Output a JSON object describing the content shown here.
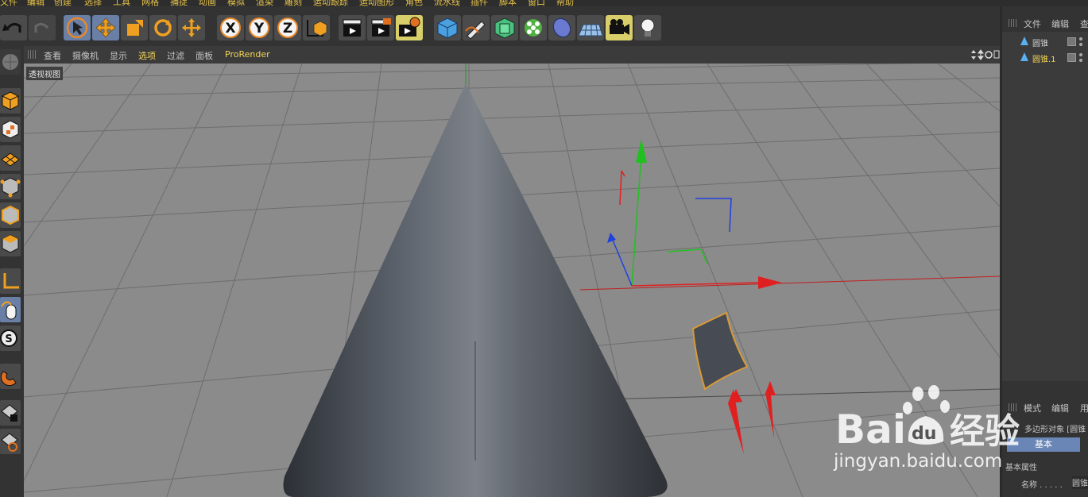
{
  "menu": {
    "items": [
      "文件",
      "编辑",
      "创建",
      "选择",
      "工具",
      "网格",
      "捕捉",
      "动画",
      "模拟",
      "渲染",
      "雕刻",
      "运动跟踪",
      "运动图形",
      "角色",
      "流水线",
      "插件",
      "脚本",
      "窗口",
      "帮助"
    ]
  },
  "viewport": {
    "menu": {
      "view": "查看",
      "camera": "摄像机",
      "display": "显示",
      "options": "选项",
      "filter": "过滤",
      "panel": "面板",
      "prorender": "ProRender"
    },
    "label": "透视视图"
  },
  "object_manager": {
    "menu": {
      "file": "文件",
      "edit": "编辑",
      "view": "查"
    },
    "objects": [
      {
        "name": "圆锥",
        "selected": false
      },
      {
        "name": "圆锥.1",
        "selected": true
      }
    ]
  },
  "attributes": {
    "menu": {
      "mode": "模式",
      "edit": "编辑",
      "user": "用"
    },
    "object_title": "多边形对象 [圆锥",
    "tab_basic": "基本",
    "section": "基本属性",
    "name_label": "名称 . . . . .",
    "name_value": "圆锥"
  },
  "watermark": {
    "brand": "Bai",
    "brand2": "du",
    "cn": "经验",
    "url": "jingyan.baidu.com"
  },
  "colors": {
    "accent": "#f3d455",
    "selected_tab": "#6a86b6",
    "x_axis": "#e02020",
    "y_axis": "#20c020",
    "z_axis": "#2040e0"
  }
}
